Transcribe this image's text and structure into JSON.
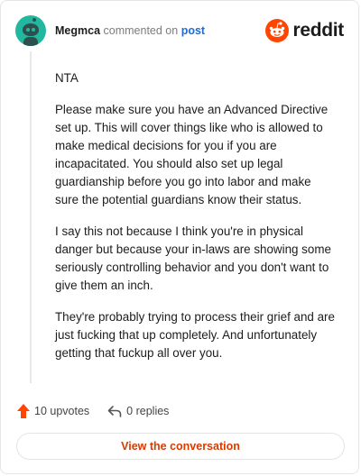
{
  "header": {
    "username": "Megmca",
    "verb": "commented on",
    "post_link": "post",
    "brand": "reddit",
    "avatar_icon": "snoo-avatar-icon",
    "brand_icon": "reddit-alien-icon"
  },
  "comment": {
    "paragraphs": [
      "NTA",
      "Please make sure you have an Advanced Directive set up. This will cover things like who is allowed to make medical decisions for you if you are incapacitated. You should also set up legal guardianship before you go into labor and make sure the potential guardians know their status.",
      "I say this not because I think you're in physical danger but because your in-laws are showing some seriously controlling behavior and you don't want to give them an inch.",
      "They're probably trying to process their grief and are just fucking that up completely. And unfortunately getting that fuckup all over you."
    ]
  },
  "actions": {
    "upvotes": "10 upvotes",
    "replies": "0 replies",
    "upvote_icon": "upvote-arrow-icon",
    "reply_icon": "reply-arrow-icon"
  },
  "footer": {
    "view_button": "View the conversation"
  },
  "colors": {
    "accent": "#ff4500",
    "link": "#1e6bd6",
    "avatar_bg": "#22b8a0",
    "button_text": "#d93a00"
  }
}
